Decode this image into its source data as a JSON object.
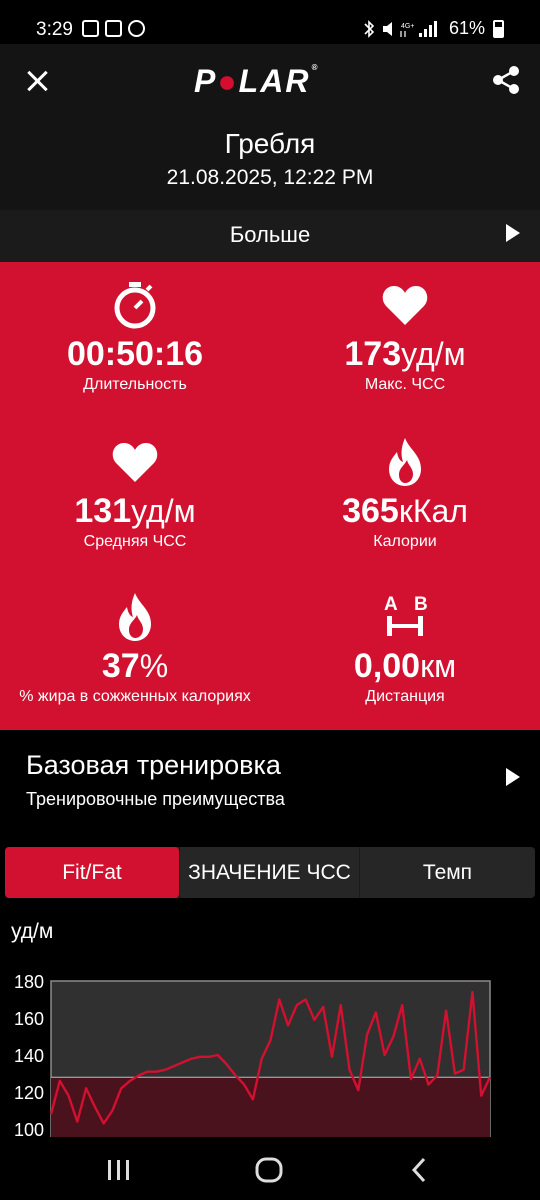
{
  "status_bar": {
    "time": "3:29",
    "battery": "61%"
  },
  "header": {
    "logo_text_pre": "P",
    "logo_text_post": "LAR"
  },
  "activity": {
    "sport": "Гребля",
    "datetime": "21.08.2025, 12:22 PM"
  },
  "more": {
    "label": "Больше"
  },
  "stats": {
    "duration": {
      "value": "00:50:16",
      "unit": "",
      "label": "Длительность"
    },
    "max_hr": {
      "value": "173",
      "unit": "уд/м",
      "label": "Макс. ЧСС"
    },
    "avg_hr": {
      "value": "131",
      "unit": "уд/м",
      "label": "Средняя ЧСС"
    },
    "calories": {
      "value": "365",
      "unit": "кКал",
      "label": "Калории"
    },
    "fat": {
      "value": "37",
      "unit": "%",
      "label": "% жира в сожженных калориях"
    },
    "distance": {
      "value": "0,00",
      "unit": "км",
      "label": "Дистанция",
      "icon_a": "A",
      "icon_b": "B"
    }
  },
  "training": {
    "title": "Базовая тренировка",
    "subtitle": "Тренировочные преимущества"
  },
  "tabs": [
    {
      "label": "Fit/Fat",
      "active": true
    },
    {
      "label": "ЗНАЧЕНИЕ ЧСС",
      "active": false
    },
    {
      "label": "Темп",
      "active": false
    }
  ],
  "chart_data": {
    "type": "line",
    "ylabel": "уд/м",
    "yticks": [
      180,
      160,
      140,
      120,
      100
    ],
    "ylim": [
      100,
      180
    ],
    "threshold": 128,
    "color": "#d2102f",
    "x": [
      0,
      1,
      2,
      3,
      4,
      5,
      6,
      7,
      8,
      9,
      10,
      11,
      12,
      13,
      14,
      15,
      16,
      17,
      18,
      19,
      20,
      21,
      22,
      23,
      24,
      25,
      26,
      27,
      28,
      29,
      30,
      31,
      32,
      33,
      34,
      35,
      36,
      37,
      38,
      39,
      40,
      41,
      42,
      43,
      44,
      45,
      46,
      47,
      48,
      49,
      50
    ],
    "values": [
      108,
      126,
      118,
      104,
      122,
      112,
      103,
      110,
      122,
      126,
      129,
      131,
      131,
      132,
      134,
      136,
      138,
      139,
      139,
      140,
      135,
      129,
      124,
      116,
      138,
      148,
      170,
      156,
      167,
      170,
      159,
      166,
      139,
      167,
      132,
      121,
      151,
      163,
      140,
      150,
      167,
      127,
      138,
      124,
      129,
      164,
      130,
      132,
      174,
      118,
      128
    ]
  }
}
